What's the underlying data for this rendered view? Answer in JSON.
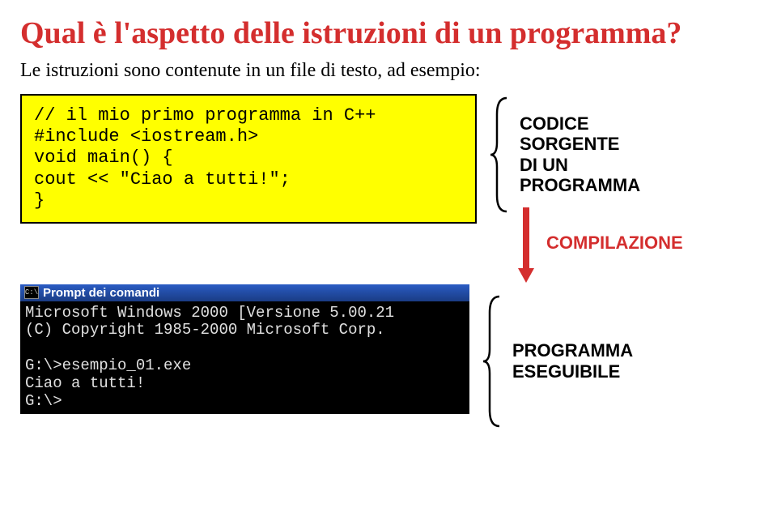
{
  "title": "Qual è l'aspetto delle istruzioni di un programma?",
  "subtitle": "Le istruzioni sono contenute in un file di testo, ad esempio:",
  "code": {
    "line1": "// il mio primo programma in C++",
    "line2": "#include <iostream.h>",
    "line3": "void main() {",
    "line4": "cout << \"Ciao a tutti!\";",
    "line5": "}"
  },
  "labels": {
    "source_code": "CODICE\nSORGENTE\nDI UN\nPROGRAMMA",
    "compilation": "COMPILAZIONE",
    "executable": "PROGRAMMA\nESEGUIBILE"
  },
  "terminal": {
    "title": "Prompt dei comandi",
    "line1": "Microsoft Windows 2000 [Versione 5.00.21",
    "line2": "(C) Copyright 1985-2000 Microsoft Corp.",
    "line3": "",
    "line4": "G:\\>esempio_01.exe",
    "line5": "Ciao a tutti!",
    "line6": "G:\\>"
  }
}
